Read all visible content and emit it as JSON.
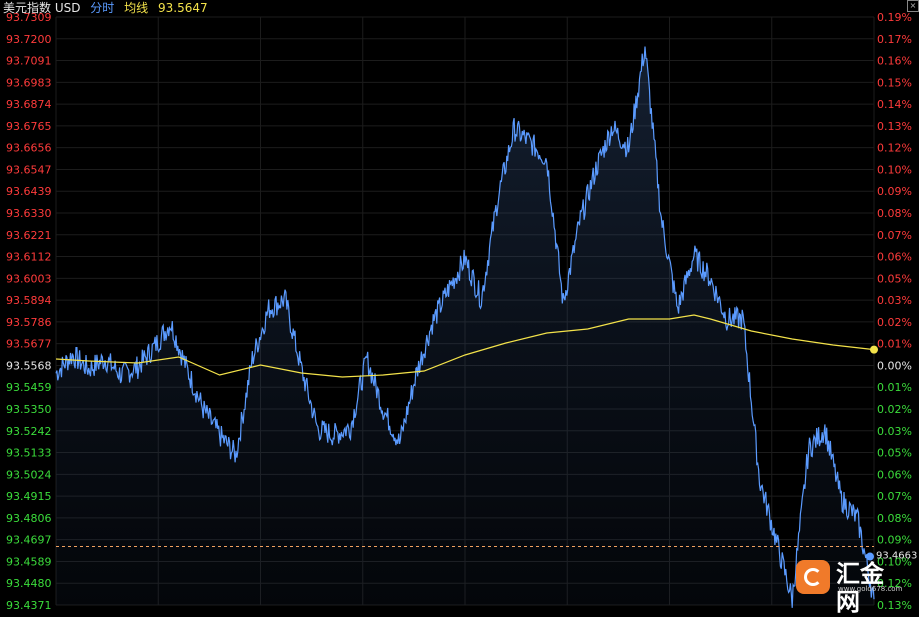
{
  "header": {
    "instrument": "美元指数 USD",
    "mode": "分时",
    "avg_label": "均线",
    "avg_value": "93.5647"
  },
  "logo": {
    "text": "汇金网",
    "url": "www.gold678.com"
  },
  "colors": {
    "price_line": "#5b9bff",
    "avg_line": "#f3e24a",
    "up": "#ff3b3b",
    "down": "#3bdc3b",
    "last_price_line": "#f0a060"
  },
  "chart_data": {
    "type": "line",
    "title": "美元指数 USD",
    "base_price": 93.5568,
    "last_price": 93.4663,
    "last_avg": 93.5647,
    "grid": true,
    "ylim": [
      93.4371,
      93.7309
    ],
    "y_ticks_left": [
      "93.7309",
      "93.7200",
      "93.7091",
      "93.6983",
      "93.6874",
      "93.6765",
      "93.6656",
      "93.6547",
      "93.6439",
      "93.6330",
      "93.6221",
      "93.6112",
      "93.6003",
      "93.5894",
      "93.5786",
      "93.5677",
      "93.5568",
      "93.5459",
      "93.5350",
      "93.5242",
      "93.5133",
      "93.5024",
      "93.4915",
      "93.4806",
      "93.4697",
      "93.4589",
      "93.4480",
      "93.4371"
    ],
    "y_ticks_right": [
      "0.19%",
      "0.17%",
      "0.16%",
      "0.15%",
      "0.14%",
      "0.13%",
      "0.12%",
      "0.10%",
      "0.09%",
      "0.08%",
      "0.07%",
      "0.06%",
      "0.05%",
      "0.03%",
      "0.02%",
      "0.01%",
      "0.00%",
      "0.01%",
      "0.02%",
      "0.03%",
      "0.05%",
      "0.06%",
      "0.07%",
      "0.08%",
      "0.09%",
      "0.10%",
      "0.12%",
      "0.13%"
    ],
    "series": [
      {
        "type": "price",
        "x": [
          0,
          0.02,
          0.04,
          0.06,
          0.08,
          0.1,
          0.12,
          0.14,
          0.16,
          0.18,
          0.2,
          0.22,
          0.24,
          0.26,
          0.28,
          0.3,
          0.32,
          0.34,
          0.36,
          0.38,
          0.4,
          0.42,
          0.44,
          0.46,
          0.48,
          0.5,
          0.52,
          0.54,
          0.56,
          0.58,
          0.6,
          0.62,
          0.64,
          0.66,
          0.68,
          0.7,
          0.72,
          0.74,
          0.76,
          0.78,
          0.8,
          0.82,
          0.84,
          0.86,
          0.88,
          0.9,
          0.92,
          0.94,
          0.96,
          0.98,
          1.0
        ],
        "values": [
          93.553,
          93.562,
          93.555,
          93.56,
          93.552,
          93.556,
          93.566,
          93.578,
          93.555,
          93.535,
          93.522,
          93.512,
          93.56,
          93.585,
          93.59,
          93.555,
          93.525,
          93.522,
          93.526,
          93.56,
          93.535,
          93.518,
          93.552,
          93.578,
          93.595,
          93.61,
          93.59,
          93.64,
          93.675,
          93.668,
          93.66,
          93.588,
          93.628,
          93.655,
          93.676,
          93.665,
          93.716,
          93.63,
          93.585,
          93.612,
          93.6,
          93.58,
          93.58,
          93.5,
          93.47,
          93.44,
          93.515,
          93.525,
          93.49,
          93.48,
          93.44
        ]
      },
      {
        "type": "average",
        "x": [
          0,
          0.04,
          0.1,
          0.15,
          0.2,
          0.25,
          0.3,
          0.35,
          0.4,
          0.45,
          0.5,
          0.55,
          0.6,
          0.65,
          0.7,
          0.75,
          0.78,
          0.8,
          0.85,
          0.9,
          0.95,
          1.0
        ],
        "values": [
          93.56,
          93.559,
          93.558,
          93.561,
          93.552,
          93.557,
          93.553,
          93.551,
          93.552,
          93.554,
          93.562,
          93.568,
          93.573,
          93.575,
          93.58,
          93.58,
          93.582,
          93.58,
          93.574,
          93.57,
          93.567,
          93.5647
        ]
      }
    ]
  }
}
